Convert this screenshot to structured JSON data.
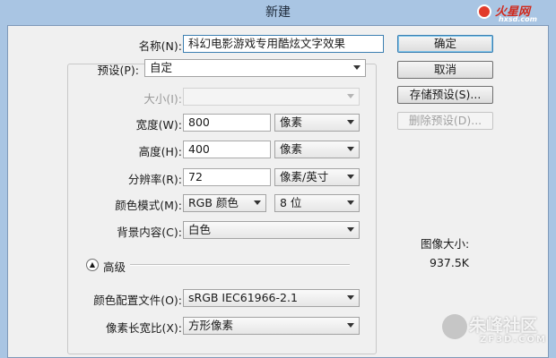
{
  "window": {
    "title": "新建"
  },
  "form": {
    "name_label": "名称(N):",
    "name_value": "科幻电影游戏专用酷炫文字效果",
    "preset_label": "预设(P):",
    "preset_value": "自定",
    "size_label": "大小(I):",
    "size_value": "",
    "width_label": "宽度(W):",
    "width_value": "800",
    "width_unit": "像素",
    "height_label": "高度(H):",
    "height_value": "400",
    "height_unit": "像素",
    "resolution_label": "分辨率(R):",
    "resolution_value": "72",
    "resolution_unit": "像素/英寸",
    "color_mode_label": "颜色模式(M):",
    "color_mode_value": "RGB 颜色",
    "bit_depth_value": "8 位",
    "background_label": "背景内容(C):",
    "background_value": "白色",
    "advanced_label": "高级",
    "color_profile_label": "颜色配置文件(O):",
    "color_profile_value": "sRGB IEC61966-2.1",
    "pixel_aspect_label": "像素长宽比(X):",
    "pixel_aspect_value": "方形像素"
  },
  "buttons": {
    "ok": "确定",
    "cancel": "取消",
    "save_preset": "存储预设(S)...",
    "delete_preset": "删除预设(D)..."
  },
  "image_size": {
    "label": "图像大小:",
    "value": "937.5K"
  },
  "watermarks": {
    "top_right_logo": "火星网",
    "top_right_url": "hxsd.com",
    "bottom_right_logo": "朱峰社区",
    "bottom_right_url": "ZF3D.COM"
  },
  "colors": {
    "title_bar": "#a9c5e3",
    "dialog_bg": "#f0f0f0",
    "focus_border": "#3c7fb1"
  }
}
